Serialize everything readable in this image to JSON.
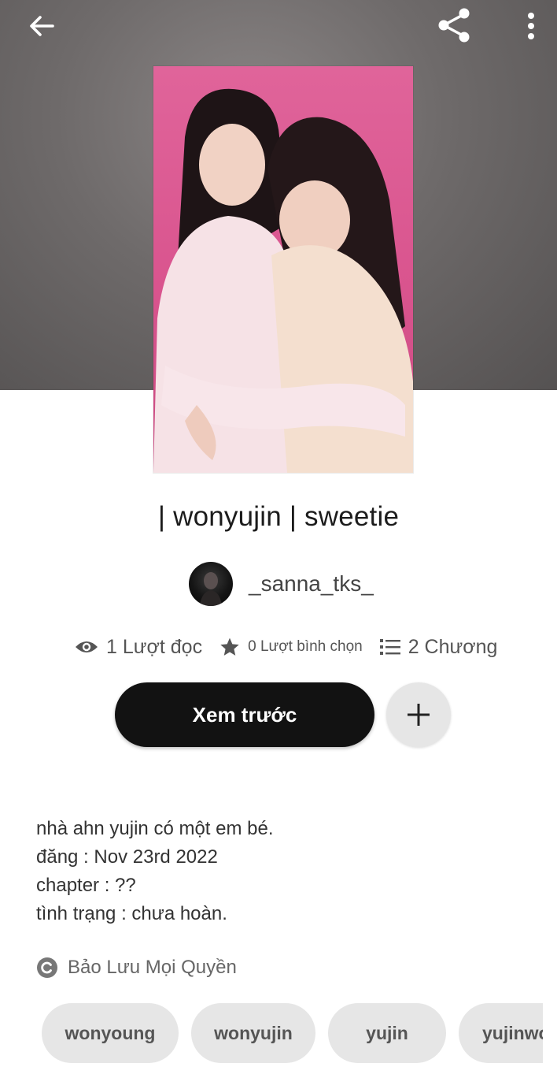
{
  "story": {
    "title": "| wonyujin | sweetie",
    "author": "_sanna_tks_",
    "stats": {
      "reads": "1 Lượt đọc",
      "votes": "0 Lượt bình chọn",
      "parts": "2 Chương"
    },
    "preview_label": "Xem trước",
    "description": [
      "nhà ahn yujin có một em bé.",
      "đăng : Nov 23rd 2022",
      "chapter : ??",
      "tình trạng : chưa hoàn."
    ],
    "copyright": "Bảo Lưu Mọi Quyền",
    "tags": [
      "wonyoung",
      "wonyujin",
      "yujin",
      "yujinwo"
    ]
  },
  "icons": {
    "back": "arrow-back-icon",
    "share": "share-icon",
    "more": "more-vertical-icon",
    "reads": "eye-icon",
    "votes": "star-icon",
    "parts": "list-icon",
    "add": "plus-icon",
    "copyright": "copyright-icon"
  },
  "colors": {
    "header_bg": "#6e6a6a",
    "cover_bg": "#d9548e",
    "primary_button": "#121212",
    "secondary_button": "#e6e6e6",
    "tag_bg": "#e6e6e6"
  }
}
